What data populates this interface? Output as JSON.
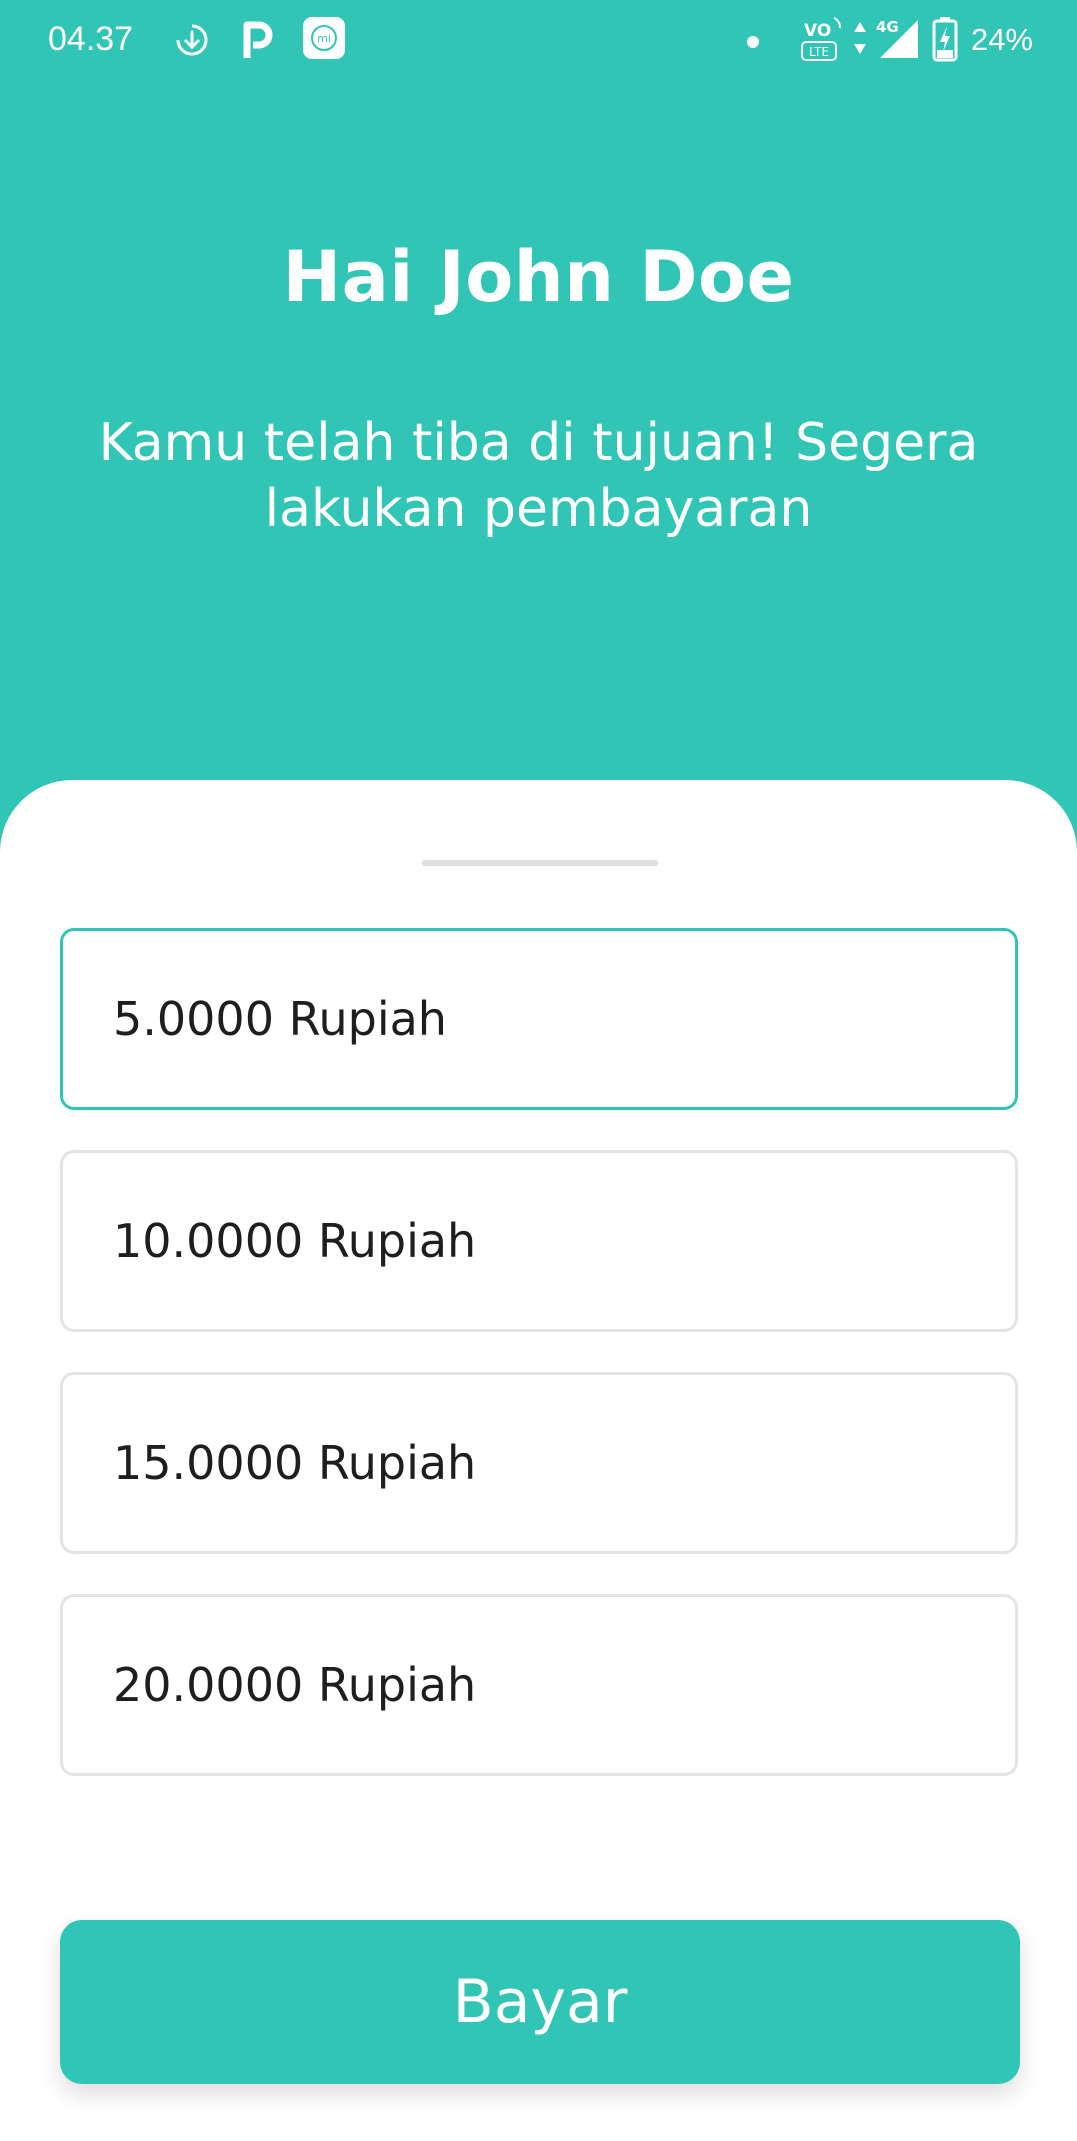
{
  "status_bar": {
    "time": "04.37",
    "icons": [
      "download-icon",
      "p-app-icon",
      "mi-app-icon",
      "dot-icon",
      "volte-icon",
      "data-arrows-icon",
      "signal-4g-icon",
      "battery-charging-icon"
    ],
    "volte_label": "VO",
    "lte_label": "LTE",
    "network_label": "4G",
    "battery": "24%"
  },
  "header": {
    "greeting": "Hai John Doe",
    "message": "Kamu telah tiba di tujuan! Segera lakukan pembayaran"
  },
  "payment_options": [
    {
      "label": "5.0000 Rupiah",
      "selected": true
    },
    {
      "label": "10.0000 Rupiah",
      "selected": false
    },
    {
      "label": "15.0000 Rupiah",
      "selected": false
    },
    {
      "label": "20.0000 Rupiah",
      "selected": false
    }
  ],
  "pay_button_label": "Bayar",
  "colors": {
    "accent": "#30c5b5",
    "sheet": "#ffffff",
    "option_border": "#e4e4e4",
    "text_dark": "#1e1e1e"
  }
}
